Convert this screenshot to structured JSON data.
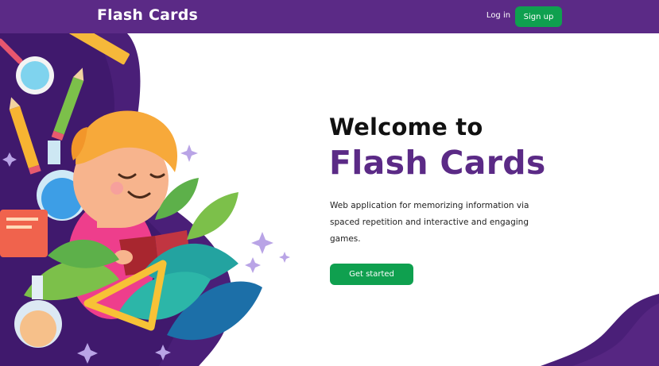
{
  "header": {
    "brand": "Flash Cards",
    "login_label": "Log in",
    "signup_label": "Sign up"
  },
  "hero": {
    "title_line1": "Welcome to",
    "title_line2": "Flash Cards",
    "description": "Web application for memorizing information via spaced repetition and interactive and engaging games.",
    "cta_label": "Get started"
  },
  "colors": {
    "brand_purple": "#5b2a86",
    "accent_green": "#0fa04f"
  }
}
